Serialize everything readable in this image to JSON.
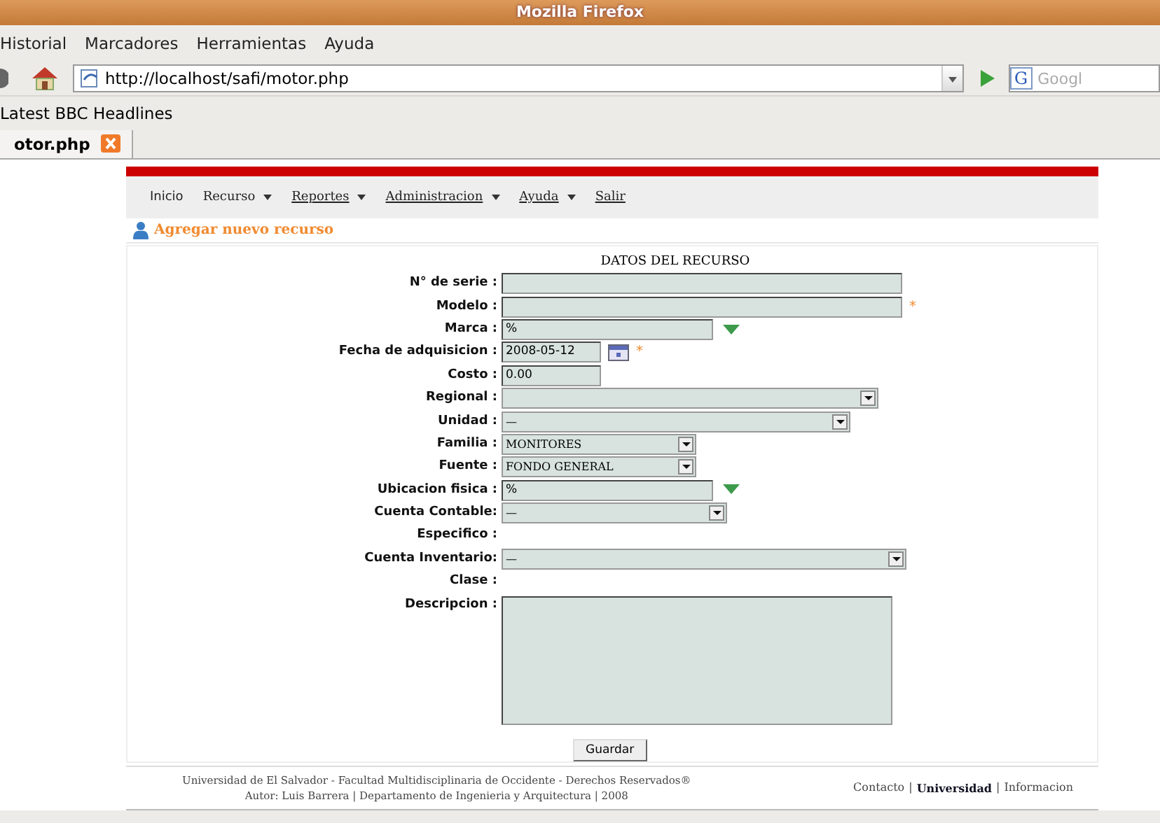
{
  "window": {
    "title": "Mozilla Firefox"
  },
  "menu_bar": [
    {
      "label": "Historial"
    },
    {
      "label": "Marcadores"
    },
    {
      "label": "Herramientas"
    },
    {
      "label": "Ayuda"
    }
  ],
  "address_bar": {
    "value": "http://localhost/safi/motor.php"
  },
  "search_box": {
    "engine": "G",
    "placeholder": "Googl"
  },
  "bookmarks": [
    "Latest BBC Headlines"
  ],
  "tabs": [
    {
      "label": "otor.php",
      "selected": true
    }
  ],
  "site_menu": [
    {
      "label": "Inicio",
      "has_menu": false,
      "underlined": false
    },
    {
      "label": "Recurso",
      "has_menu": true,
      "underlined": false
    },
    {
      "label": "Reportes",
      "has_menu": true,
      "underlined": true
    },
    {
      "label": "Administracion",
      "has_menu": true,
      "underlined": true
    },
    {
      "label": "Ayuda",
      "has_menu": true,
      "underlined": true
    },
    {
      "label": "Salir",
      "has_menu": false,
      "underlined": true
    }
  ],
  "page_title": "Agregar nuevo recurso",
  "form": {
    "heading": "DATOS DEL RECURSO",
    "required_mark": "*",
    "fields": [
      {
        "label": "N° de serie :",
        "kind": "text",
        "required": false
      },
      {
        "label": "Modelo :",
        "kind": "text",
        "required": true
      },
      {
        "label": "Marca :",
        "kind": "combo",
        "value": "%",
        "required": false
      },
      {
        "label": "Fecha de adquisicion :",
        "kind": "date",
        "value": "2008-05-12",
        "required": true
      },
      {
        "label": "Costo :",
        "kind": "text",
        "value": "0.00",
        "required": false
      },
      {
        "label": "Regional :",
        "kind": "select",
        "required": false
      },
      {
        "label": "Unidad :",
        "kind": "select",
        "value": "—",
        "required": false
      },
      {
        "label": "Familia :",
        "kind": "select",
        "value": "MONITORES",
        "required": false
      },
      {
        "label": "Fuente :",
        "kind": "select",
        "value": "FONDO GENERAL",
        "required": false
      },
      {
        "label": "Ubicacion fisica :",
        "kind": "combo",
        "value": "%",
        "required": false
      },
      {
        "label": "Cuenta Contable:",
        "kind": "select",
        "value": "—",
        "required": false
      },
      {
        "label": "Especifico :",
        "kind": "none",
        "required": false
      },
      {
        "label": "Cuenta Inventario:",
        "kind": "select",
        "value": "—",
        "required": false
      },
      {
        "label": "Clase :",
        "kind": "none",
        "required": false
      },
      {
        "label": "Descripcion :",
        "kind": "textarea",
        "required": false
      }
    ],
    "submit": "Guardar"
  },
  "footer": {
    "lines": [
      "Universidad de El Salvador - Facultad Multidisciplinaria de Occidente - Derechos Reservados®",
      "Autor: Luis Barrera | Departamento de Ingenieria y Arquitectura | 2008"
    ],
    "links": [
      {
        "label": "Contacto",
        "bold": false
      },
      {
        "label": "Universidad",
        "bold": true
      },
      {
        "label": "Informacion",
        "bold": false
      }
    ],
    "separator": "|"
  }
}
